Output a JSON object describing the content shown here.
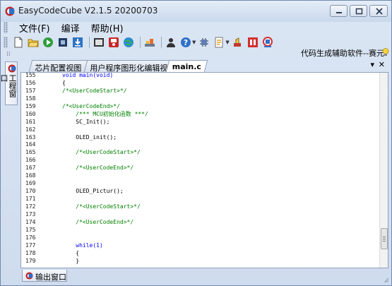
{
  "window": {
    "title": "EasyCodeCube V2.1.5 20200703"
  },
  "menubar": {
    "items": [
      "文件(F)",
      "编译",
      "帮助(H)"
    ]
  },
  "toolbar": {
    "buttons": [
      {
        "name": "new-file-icon"
      },
      {
        "name": "open-folder-icon"
      },
      {
        "name": "play-icon"
      },
      {
        "name": "chip-icon"
      },
      {
        "name": "download-icon"
      },
      {
        "name": "board-icon"
      },
      {
        "name": "save-red-icon"
      },
      {
        "name": "globe-icon"
      },
      {
        "name": "build-icon"
      },
      {
        "name": "user-icon"
      },
      {
        "name": "help-icon"
      },
      {
        "name": "component-icon"
      },
      {
        "name": "document-icon"
      },
      {
        "name": "tool-icon"
      },
      {
        "name": "logo-a-icon"
      },
      {
        "name": "logo-b-icon"
      }
    ]
  },
  "caption": "代码生成辅助软件--赛元",
  "leftpanel": {
    "tab_label": "工程窗口"
  },
  "tabs": [
    {
      "label": "芯片配置视图",
      "active": false
    },
    {
      "label": "用户程序图形化编辑视图",
      "active": false
    },
    {
      "label": "main.c",
      "active": true
    }
  ],
  "tab_controls": {
    "dropdown": "▾",
    "close": "✕"
  },
  "editor": {
    "lines": [
      {
        "n": "155",
        "text": "void main(void)",
        "cls": "keyword"
      },
      {
        "n": "156",
        "text": "{",
        "cls": ""
      },
      {
        "n": "157",
        "text": "/*<UserCodeStart>*/",
        "cls": "comment"
      },
      {
        "n": "158",
        "text": "",
        "cls": ""
      },
      {
        "n": "159",
        "text": "/*<UserCodeEnd>*/",
        "cls": "comment"
      },
      {
        "n": "160",
        "text": "    /*** MCU初始化函数 ***/",
        "cls": "comment"
      },
      {
        "n": "161",
        "text": "    SC_Init();",
        "cls": ""
      },
      {
        "n": "162",
        "text": "",
        "cls": ""
      },
      {
        "n": "163",
        "text": "    OLED_init();",
        "cls": ""
      },
      {
        "n": "164",
        "text": "",
        "cls": ""
      },
      {
        "n": "165",
        "text": "    /*<UserCodeStart>*/",
        "cls": "comment"
      },
      {
        "n": "166",
        "text": "",
        "cls": ""
      },
      {
        "n": "167",
        "text": "    /*<UserCodeEnd>*/",
        "cls": "comment"
      },
      {
        "n": "168",
        "text": "",
        "cls": ""
      },
      {
        "n": "169",
        "text": "",
        "cls": ""
      },
      {
        "n": "170",
        "text": "    OLED_Pictur();",
        "cls": ""
      },
      {
        "n": "171",
        "text": "",
        "cls": ""
      },
      {
        "n": "172",
        "text": "    /*<UserCodeStart>*/",
        "cls": "comment"
      },
      {
        "n": "173",
        "text": "",
        "cls": ""
      },
      {
        "n": "174",
        "text": "    /*<UserCodeEnd>*/",
        "cls": "comment"
      },
      {
        "n": "175",
        "text": "",
        "cls": ""
      },
      {
        "n": "176",
        "text": "",
        "cls": ""
      },
      {
        "n": "177",
        "text": "    while(1)",
        "cls": "keyword"
      },
      {
        "n": "178",
        "text": "    {",
        "cls": ""
      },
      {
        "n": "179",
        "text": "    }",
        "cls": ""
      }
    ]
  },
  "bottom_panel": {
    "tab_label": "输出窗口"
  },
  "colors": {
    "comment": "#008000",
    "keyword": "#0000ff",
    "frame": "#dbe6f4"
  }
}
